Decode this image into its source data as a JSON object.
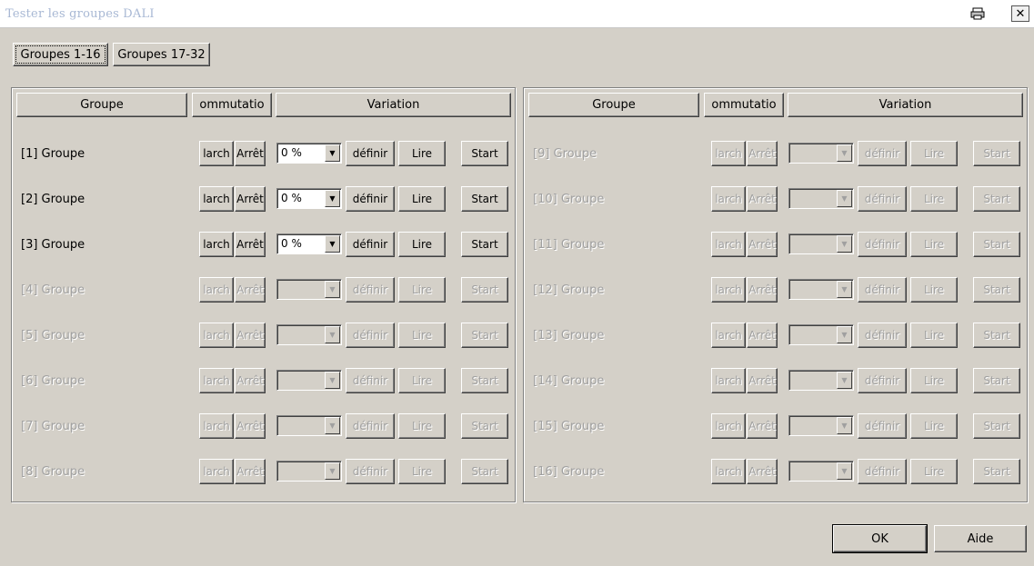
{
  "window": {
    "title": "Tester les groupes DALI",
    "print_icon": "printer-icon",
    "close_icon": "close-icon",
    "close_glyph": "✕"
  },
  "tabs": [
    {
      "label": "Groupes 1-16",
      "active": true
    },
    {
      "label": "Groupes 17-32",
      "active": false
    }
  ],
  "headers": {
    "groupe": "Groupe",
    "commutation": "ommutatio",
    "variation": "Variation"
  },
  "row_buttons": {
    "marche": "larch",
    "arret": "Arrêt",
    "definir": "définir",
    "lire": "Lire",
    "start": "Start"
  },
  "left_groups": [
    {
      "label": "[1] Groupe",
      "enabled": true,
      "level": "0 %"
    },
    {
      "label": "[2] Groupe",
      "enabled": true,
      "level": "0 %"
    },
    {
      "label": "[3] Groupe",
      "enabled": true,
      "level": "0 %"
    },
    {
      "label": "[4] Groupe",
      "enabled": false,
      "level": ""
    },
    {
      "label": "[5] Groupe",
      "enabled": false,
      "level": ""
    },
    {
      "label": "[6] Groupe",
      "enabled": false,
      "level": ""
    },
    {
      "label": "[7] Groupe",
      "enabled": false,
      "level": ""
    },
    {
      "label": "[8] Groupe",
      "enabled": false,
      "level": ""
    }
  ],
  "right_groups": [
    {
      "label": "[9] Groupe",
      "enabled": false,
      "level": ""
    },
    {
      "label": "[10] Groupe",
      "enabled": false,
      "level": ""
    },
    {
      "label": "[11] Groupe",
      "enabled": false,
      "level": ""
    },
    {
      "label": "[12] Groupe",
      "enabled": false,
      "level": ""
    },
    {
      "label": "[13] Groupe",
      "enabled": false,
      "level": ""
    },
    {
      "label": "[14] Groupe",
      "enabled": false,
      "level": ""
    },
    {
      "label": "[15] Groupe",
      "enabled": false,
      "level": ""
    },
    {
      "label": "[16] Groupe",
      "enabled": false,
      "level": ""
    }
  ],
  "footer": {
    "ok": "OK",
    "aide": "Aide"
  }
}
